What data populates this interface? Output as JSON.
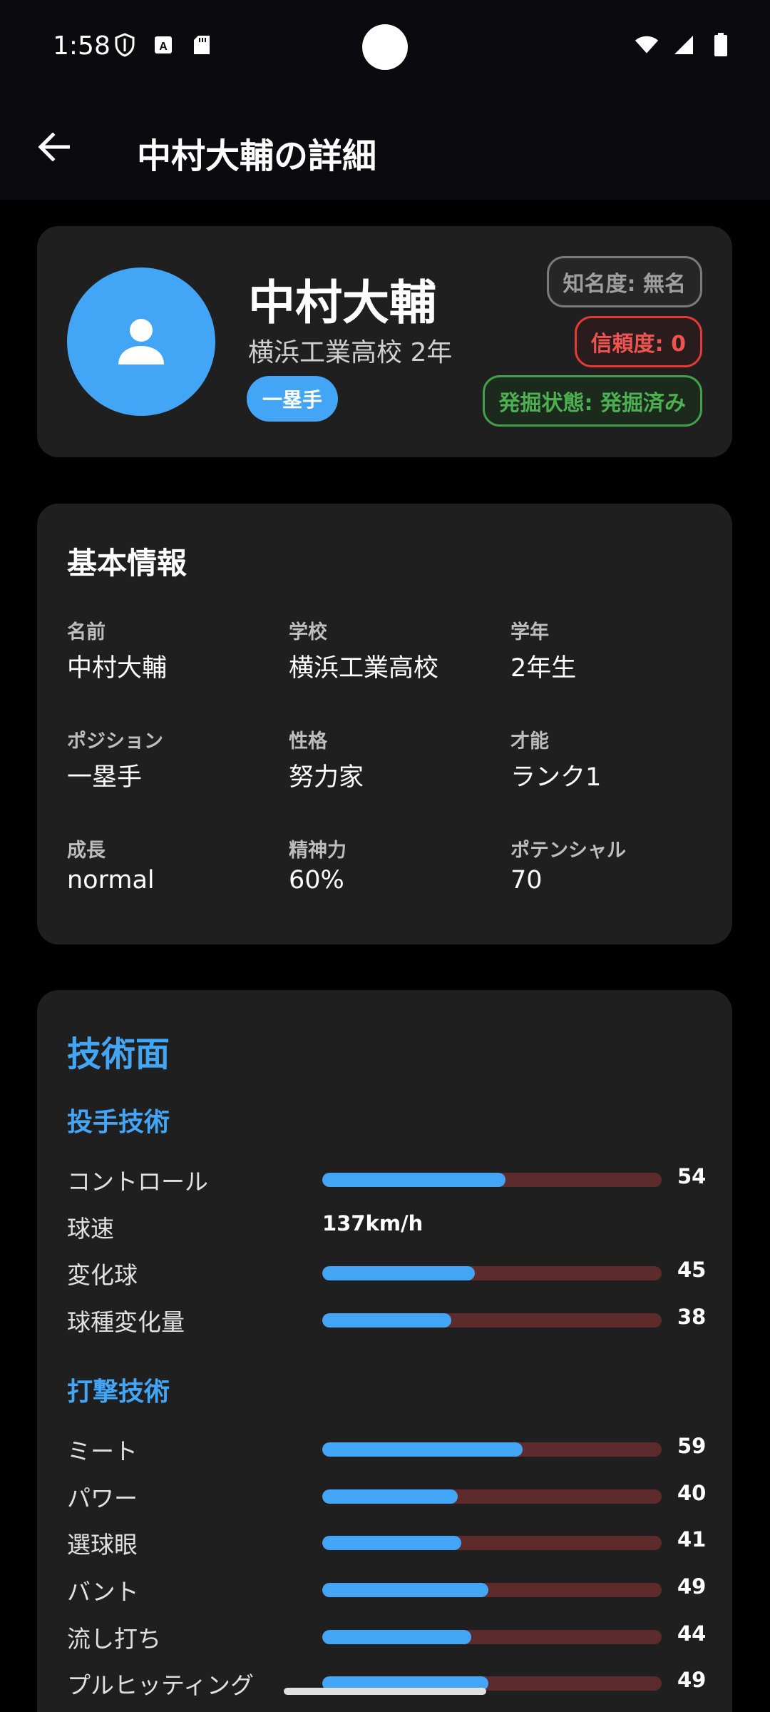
{
  "status": {
    "time": "1:58"
  },
  "appbar": {
    "title": "中村大輔の詳細"
  },
  "profile": {
    "name": "中村大輔",
    "school_grade": "横浜工業高校 2年",
    "position": "一塁手",
    "fame_badge": "知名度: 無名",
    "trust_badge": "信頼度: 0",
    "scout_badge": "発掘状態: 発掘済み"
  },
  "basic_info": {
    "title": "基本情報",
    "cells": [
      {
        "label": "名前",
        "value": "中村大輔"
      },
      {
        "label": "学校",
        "value": "横浜工業高校"
      },
      {
        "label": "学年",
        "value": "2年生"
      },
      {
        "label": "ポジション",
        "value": "一塁手"
      },
      {
        "label": "性格",
        "value": "努力家"
      },
      {
        "label": "才能",
        "value": "ランク1"
      },
      {
        "label": "成長",
        "value": "normal"
      },
      {
        "label": "精神力",
        "value": "60%"
      },
      {
        "label": "ポテンシャル",
        "value": "70"
      }
    ]
  },
  "tech": {
    "title": "技術面",
    "pitching_title": "投手技術",
    "batting_title": "打撃技術",
    "pitching": [
      {
        "label": "コントロール",
        "value": 54
      },
      {
        "label": "球速",
        "text": "137km/h"
      },
      {
        "label": "変化球",
        "value": 45
      },
      {
        "label": "球種変化量",
        "value": 38
      }
    ],
    "batting": [
      {
        "label": "ミート",
        "value": 59
      },
      {
        "label": "パワー",
        "value": 40
      },
      {
        "label": "選球眼",
        "value": 41
      },
      {
        "label": "バント",
        "value": 49
      },
      {
        "label": "流し打ち",
        "value": 44
      },
      {
        "label": "プルヒッティング",
        "value": 49
      }
    ],
    "scale_max": 100
  },
  "colors": {
    "accent": "#42a5f5",
    "bar_track": "#5d2b2b",
    "card": "#1f1f1f"
  }
}
